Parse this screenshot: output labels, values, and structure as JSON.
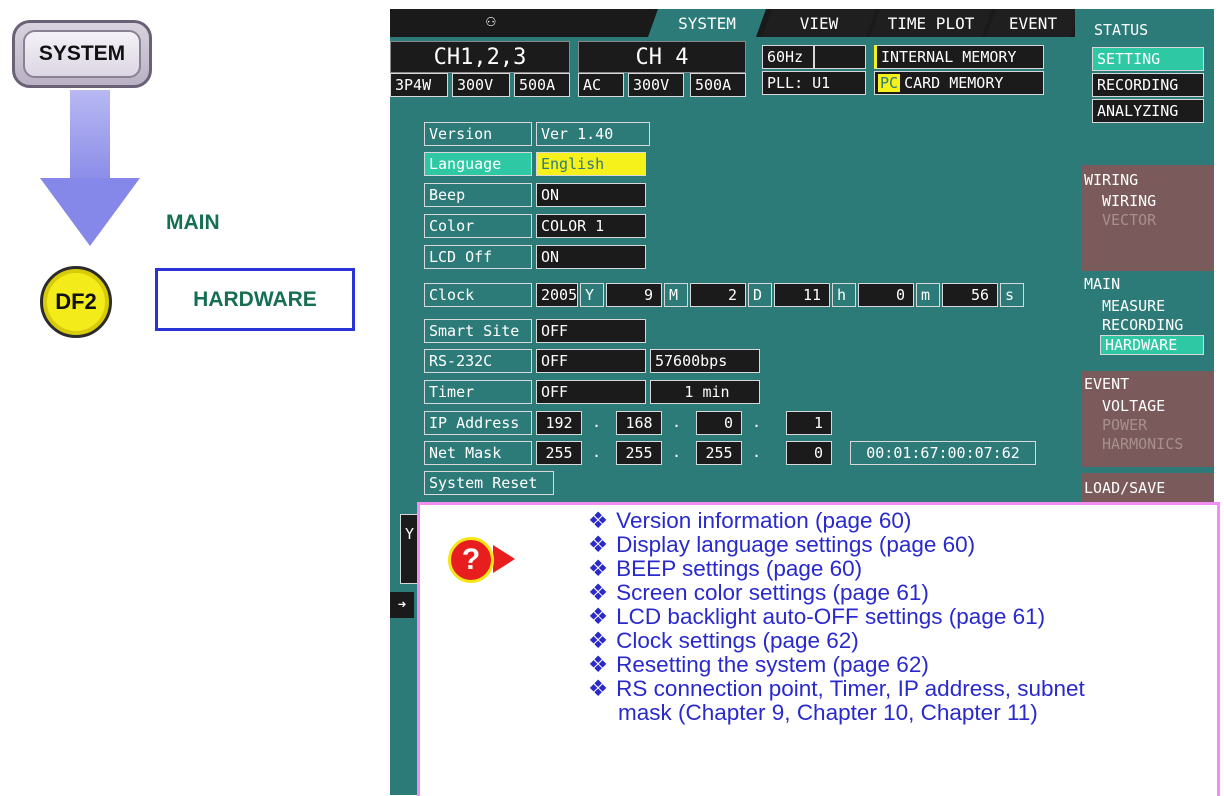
{
  "left": {
    "system_key": "SYSTEM",
    "main_label": "MAIN",
    "df_key": "DF2",
    "hardware_label": "HARDWARE"
  },
  "screen": {
    "network_icon": "network-icon",
    "tabs": [
      "SYSTEM",
      "VIEW",
      "TIME PLOT",
      "EVENT"
    ],
    "active_tab": "SYSTEM",
    "header": {
      "ch123": "CH1,2,3",
      "ch123_wiring": "3P4W",
      "ch123_volt": "300V",
      "ch123_amp": "500A",
      "ch4": "CH 4",
      "ch4_mode": "AC",
      "ch4_volt": "300V",
      "ch4_amp": "500A",
      "freq": "60Hz",
      "pll": "PLL: U1",
      "memory1": "INTERNAL MEMORY",
      "memory2_prefix": "PC",
      "memory2": "CARD  MEMORY"
    },
    "settings": {
      "version_label": "Version",
      "version_value": "Ver 1.40",
      "language_label": "Language",
      "language_value": "English",
      "beep_label": "Beep",
      "beep_value": "ON",
      "color_label": "Color",
      "color_value": "COLOR 1",
      "lcd_label": "LCD Off",
      "lcd_value": "ON",
      "clock_label": "Clock",
      "clock": {
        "year": "2005",
        "y": "Y",
        "month": "9",
        "m": "M",
        "day": "2",
        "d": "D",
        "hour": "11",
        "h": "h",
        "minute": "0",
        "mi": "m",
        "second": "56",
        "s": "s"
      },
      "smart_label": "Smart Site",
      "smart_value": "OFF",
      "rs_label": "RS-232C",
      "rs_value": "OFF",
      "rs_speed": "57600bps",
      "timer_label": "Timer",
      "timer_value": "OFF",
      "timer_interval": "1 min",
      "ip_label": "IP Address",
      "ip": [
        "192",
        "168",
        "0",
        "1"
      ],
      "mask_label": "Net Mask",
      "mask": [
        "255",
        "255",
        "255",
        "0"
      ],
      "dot": ".",
      "mac": "00:01:67:00:07:62",
      "reset_label": "System Reset",
      "partial_y": "Y"
    },
    "sidebar": {
      "status": "STATUS",
      "setting": "SETTING",
      "recording": "RECORDING",
      "analyzing": "ANALYZING",
      "wiring_title": "WIRING",
      "wiring_item1": "WIRING",
      "wiring_item2": "VECTOR",
      "main_title": "MAIN",
      "main_item1": "MEASURE",
      "main_item2": "RECORDING",
      "main_item3": "HARDWARE",
      "event_title": "EVENT",
      "event_item1": "VOLTAGE",
      "event_item2": "POWER",
      "event_item3": "HARMONICS",
      "load_save": "LOAD/SAVE"
    },
    "colors": {
      "screen_bg": "#2c7b78",
      "highlight_yellow": "#f6f11a",
      "selected_green": "#2fc8a5",
      "side_group": "#7a5a5a"
    }
  },
  "help": {
    "icon": "?",
    "bullet": "❖",
    "items": [
      "Version information (page 60)",
      "Display language settings (page 60)",
      "BEEP settings (page 60)",
      "Screen color settings (page 61)",
      "LCD backlight auto-OFF settings (page 61)",
      "Clock settings (page 62)",
      "Resetting the system (page 62)",
      "RS connection point, Timer, IP address, subnet",
      "mask (Chapter 9, Chapter 10, Chapter 11)"
    ]
  }
}
